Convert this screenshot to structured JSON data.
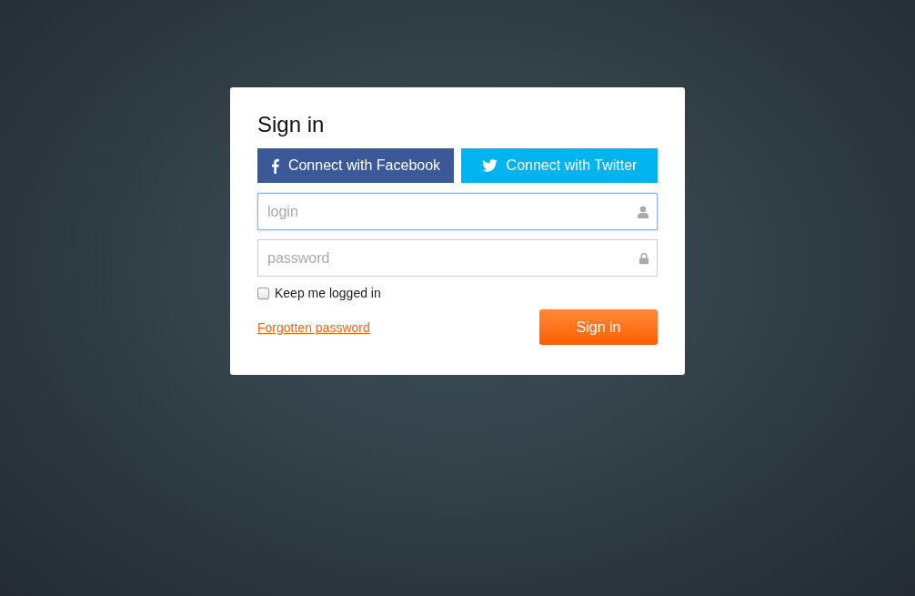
{
  "title": "Sign in",
  "social_buttons": [
    {
      "kind": "facebook",
      "label": "Connect with Facebook"
    },
    {
      "kind": "twitter",
      "label": "Connect with Twitter"
    }
  ],
  "fields": [
    {
      "kind": "user",
      "placeholder": "login",
      "focused": true
    },
    {
      "kind": "lock",
      "placeholder": "password",
      "focused": false
    }
  ],
  "remember": {
    "label": "Keep me logged in",
    "checked": false
  },
  "forgot_link": "Forgotten password",
  "submit_button": "Sign in"
}
